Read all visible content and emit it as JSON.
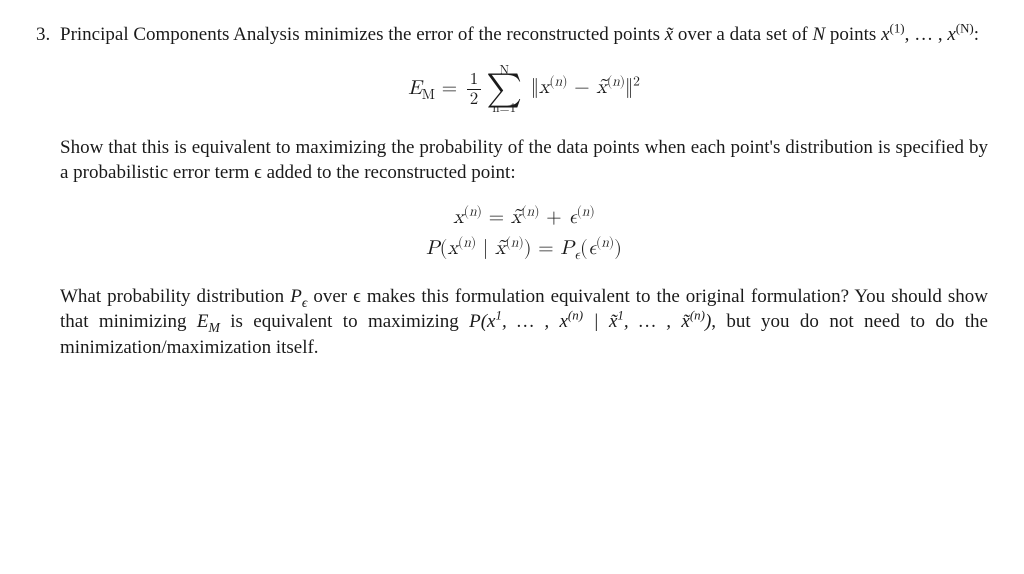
{
  "item_number": "3.",
  "paragraphs": {
    "p1_pre": "Principal Components Analysis minimizes the error of the reconstructed points ",
    "p1_sym1": "x̃",
    "p1_mid": " over a data set of ",
    "p1_N": "N",
    "p1_mid2": " points ",
    "p1_pts": "x",
    "p1_sup1": "(1)",
    "p1_dots": ", … , ",
    "p1_supN": "(N)",
    "p1_end": ":",
    "p2": "Show that this is equivalent to maximizing the probability of the data points when each point's distribution is specified by a probabilistic error term ϵ added to the reconstructed point:",
    "p3_a": "What probability distribution ",
    "p3_Pe": "P",
    "p3_Pe_sub": "ϵ",
    "p3_b": " over ϵ makes this formulation equivalent to the original formulation?   You should show that minimizing ",
    "p3_EM": "E",
    "p3_EM_sub": "M",
    "p3_c": " is equivalent to maximizing ",
    "p3_d": ", but you do not need to do the minimization/maximization itself."
  },
  "eq1": {
    "lhs_E": "E",
    "lhs_M": "M",
    "eq": " = ",
    "frac_num": "1",
    "frac_den": "2",
    "sum_top": "N",
    "sum_bot": "n=1",
    "body": "‖x(n) − x̃(n)‖2"
  },
  "eq2": {
    "line1": "x(n) = x̃(n) + ϵ(n)",
    "line2": "P(x(n) | x̃(n)) = Pϵ(ϵ(n))"
  },
  "eq_inline": {
    "joint": "P(x1, … , x(n) | x̃1, … , x̃(n))"
  }
}
